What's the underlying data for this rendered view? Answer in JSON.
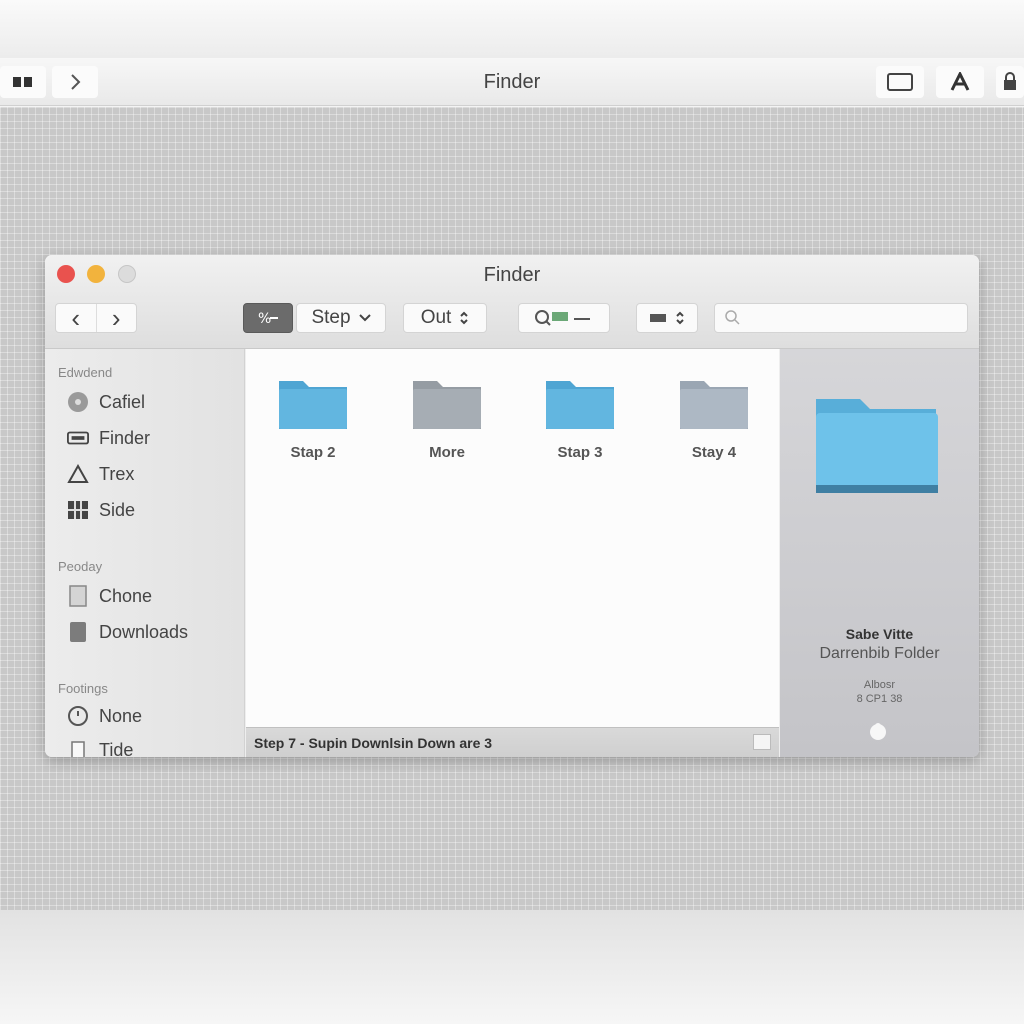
{
  "menubar": {
    "title": "Finder",
    "left_icon": "sidebar-icon",
    "forward_icon": "chevron-right-icon",
    "right_icons": [
      "window-icon",
      "text-icon",
      "lock-icon"
    ]
  },
  "window": {
    "title": "Finder",
    "traffic_colors": {
      "close": "#e9524e",
      "minimize": "#f2b33d",
      "zoom": "#dcdcdc"
    },
    "toolbar": {
      "back": "‹",
      "forward": "›",
      "action_label": "Step",
      "sort_label": "Out",
      "search_placeholder": ""
    }
  },
  "sidebar": {
    "sections": [
      {
        "heading": "Edwdend",
        "items": [
          {
            "label": "Cafiel",
            "icon": "disc-icon"
          },
          {
            "label": "Finder",
            "icon": "display-icon"
          },
          {
            "label": "Trex",
            "icon": "apps-icon"
          },
          {
            "label": "Side",
            "icon": "grid-icon"
          }
        ]
      },
      {
        "heading": "Peoday",
        "items": [
          {
            "label": "Chone",
            "icon": "document-icon"
          },
          {
            "label": "Downloads",
            "icon": "downloads-icon"
          }
        ]
      },
      {
        "heading": "Footings",
        "items": [
          {
            "label": "None",
            "icon": "clock-icon"
          },
          {
            "label": "Tide",
            "icon": "file-icon"
          }
        ]
      }
    ]
  },
  "folders": [
    {
      "name": "Stap 2",
      "color": "#62b6e0"
    },
    {
      "name": "More",
      "color": "#a6adb4"
    },
    {
      "name": "Stap 3",
      "color": "#62b6e0"
    },
    {
      "name": "Stay 4",
      "color": "#adb8c4"
    }
  ],
  "status": {
    "text": "Step 7 - Supin Downlsin Down are 3"
  },
  "preview": {
    "name": "Sabe Vitte",
    "kind": "Darrenbib Folder",
    "meta1": "Albosr",
    "meta2": "8 CP1 38",
    "folder_color": "#6ec2ea"
  }
}
